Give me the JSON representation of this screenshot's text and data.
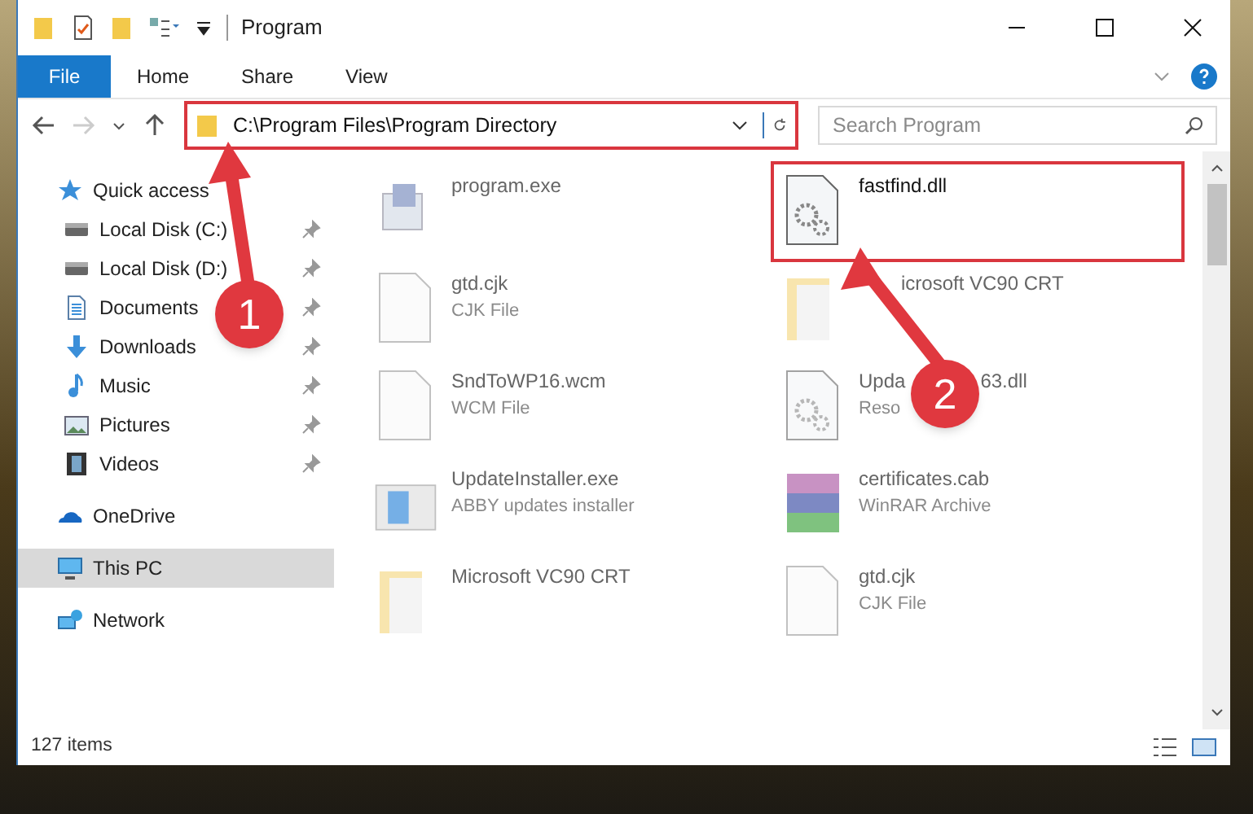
{
  "window": {
    "title": "Program"
  },
  "ribbon_tabs": [
    {
      "label": "File",
      "selected": true
    },
    {
      "label": "Home",
      "selected": false
    },
    {
      "label": "Share",
      "selected": false
    },
    {
      "label": "View",
      "selected": false
    }
  ],
  "address": {
    "path": "C:\\Program Files\\Program Directory"
  },
  "search": {
    "placeholder": "Search Program"
  },
  "sidebar": {
    "items": [
      {
        "label": "Quick access",
        "kind": "star",
        "pinned": false,
        "selected": false,
        "children": [
          {
            "label": "Local Disk (C:)",
            "kind": "disk",
            "pinned": true,
            "selected": false
          },
          {
            "label": "Local Disk (D:)",
            "kind": "disk",
            "pinned": true,
            "selected": false
          },
          {
            "label": "Documents",
            "kind": "doc",
            "pinned": true,
            "selected": false
          },
          {
            "label": "Downloads",
            "kind": "download",
            "pinned": true,
            "selected": false
          },
          {
            "label": "Music",
            "kind": "music",
            "pinned": true,
            "selected": false
          },
          {
            "label": "Pictures",
            "kind": "picture",
            "pinned": true,
            "selected": false
          },
          {
            "label": "Videos",
            "kind": "video",
            "pinned": true,
            "selected": false
          }
        ]
      },
      {
        "label": "OneDrive",
        "kind": "cloud",
        "pinned": false,
        "selected": false
      },
      {
        "label": "This PC",
        "kind": "pc",
        "pinned": false,
        "selected": true
      },
      {
        "label": "Network",
        "kind": "network",
        "pinned": false,
        "selected": false
      }
    ]
  },
  "files": [
    {
      "name": "program.exe",
      "kind": "exe",
      "highlighted": false
    },
    {
      "name": "fastfind.dll",
      "kind": "dll",
      "highlighted": true
    },
    {
      "name": "gtd.cjk",
      "type": "CJK File",
      "kind": "blank",
      "highlighted": false
    },
    {
      "name": "icrosoft VC90 CRT",
      "kind": "folder",
      "highlighted": false
    },
    {
      "name": "SndToWP16.wcm",
      "type": "WCM File",
      "kind": "blank",
      "highlighted": false
    },
    {
      "name": "Upda",
      "name_end": "63.dll",
      "type": "Reso",
      "kind": "dll",
      "highlighted": false
    },
    {
      "name": "UpdateInstaller.exe",
      "type": "ABBY updates installer",
      "kind": "installer",
      "highlighted": false
    },
    {
      "name": "certificates.cab",
      "type": "WinRAR Archive",
      "kind": "archive",
      "highlighted": false
    },
    {
      "name": "Microsoft VC90 CRT",
      "kind": "folder",
      "highlighted": false
    },
    {
      "name": "gtd.cjk",
      "type": "CJK File",
      "kind": "blank",
      "highlighted": false
    }
  ],
  "status_bar": {
    "count": "127 items"
  },
  "annotations": [
    {
      "number": "1"
    },
    {
      "number": "2"
    }
  ]
}
